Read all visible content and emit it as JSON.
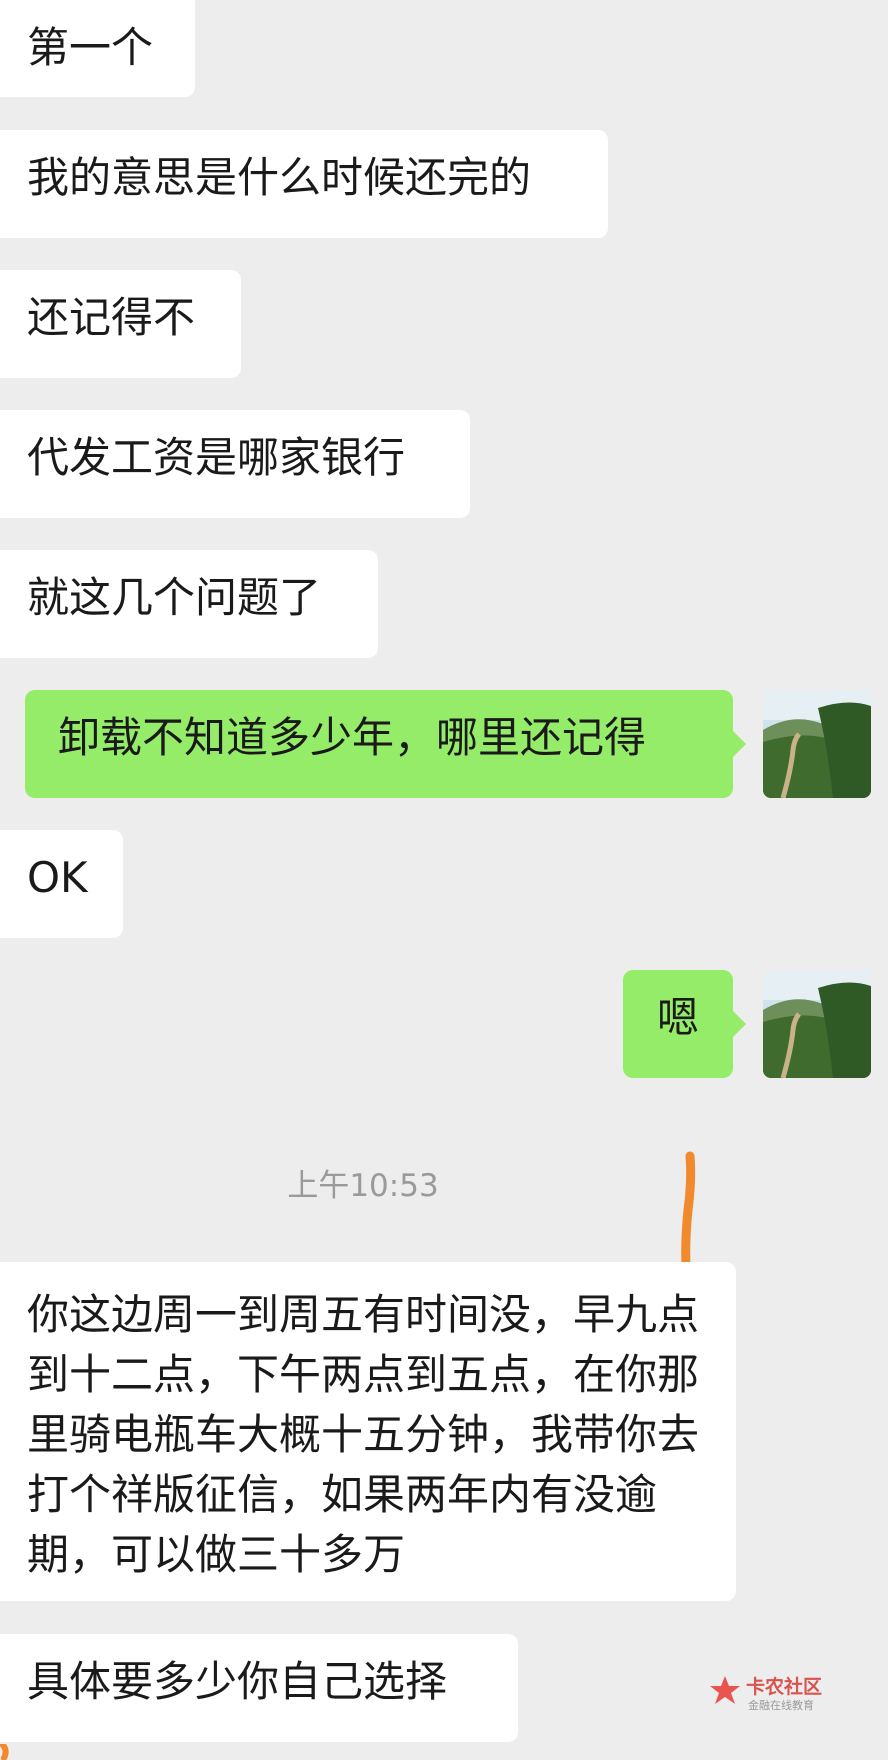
{
  "messages": [
    {
      "side": "in",
      "text": "第一个"
    },
    {
      "side": "in",
      "text": "我的意思是什么时候还完的"
    },
    {
      "side": "in",
      "text": "还记得不"
    },
    {
      "side": "in",
      "text": "代发工资是哪家银行"
    },
    {
      "side": "in",
      "text": "就这几个问题了"
    },
    {
      "side": "out",
      "text": "卸载不知道多少年，哪里还记得"
    },
    {
      "side": "in",
      "text": "OK"
    },
    {
      "side": "out",
      "text": "嗯"
    },
    {
      "side": "in",
      "text": "你这边周一到周五有时间没，早九点到十二点，下午两点到五点，在你那里骑电瓶车大概十五分钟，我带你去打个祥版征信，如果两年内有没逾期，可以做三十多万"
    },
    {
      "side": "in",
      "text": "具体要多少你自己选择"
    }
  ],
  "timestamp": "上午10:53",
  "avatar_icon": "landscape-avatar-icon",
  "watermark": {
    "title": "卡农社区",
    "subtitle": "金融在线教育"
  },
  "colors": {
    "background": "#ededed",
    "incoming_bubble": "#ffffff",
    "outgoing_bubble": "#95ec69",
    "annotation_stroke": "#f08a2c",
    "watermark_red": "#e8423c"
  }
}
